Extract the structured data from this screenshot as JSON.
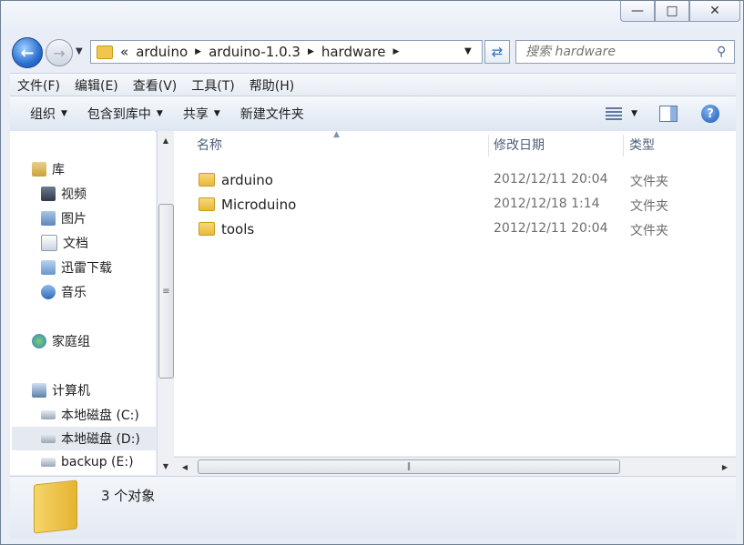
{
  "window": {
    "title_buttons": [
      "minimize",
      "maximize",
      "close"
    ]
  },
  "nav": {
    "back_icon": "back-arrow-icon",
    "forward_icon": "forward-arrow-icon",
    "breadcrumb_prefix": "«",
    "breadcrumbs": [
      "arduino",
      "arduino-1.0.3",
      "hardware"
    ],
    "search_placeholder": "搜索 hardware"
  },
  "menu": [
    "文件(F)",
    "编辑(E)",
    "查看(V)",
    "工具(T)",
    "帮助(H)"
  ],
  "toolbar": {
    "organize": "组织",
    "include_library": "包含到库中",
    "share": "共享",
    "new_folder": "新建文件夹"
  },
  "sidebar": {
    "libraries": {
      "label": "库",
      "items": [
        "视频",
        "图片",
        "文档",
        "迅雷下载",
        "音乐"
      ]
    },
    "homegroup": "家庭组",
    "computer": {
      "label": "计算机",
      "items": [
        "本地磁盘 (C:)",
        "本地磁盘 (D:)",
        "backup (E:)"
      ]
    }
  },
  "columns": {
    "name": "名称",
    "modified": "修改日期",
    "type": "类型"
  },
  "files": [
    {
      "name": "arduino",
      "modified": "2012/12/11 20:04",
      "type": "文件夹"
    },
    {
      "name": "Microduino",
      "modified": "2012/12/18 1:14",
      "type": "文件夹"
    },
    {
      "name": "tools",
      "modified": "2012/12/11 20:04",
      "type": "文件夹"
    }
  ],
  "status": {
    "count": "3 个对象"
  },
  "colors": {
    "accent": "#2a6fd1",
    "folder": "#f0c64f",
    "selected": "#e5eaf1"
  }
}
